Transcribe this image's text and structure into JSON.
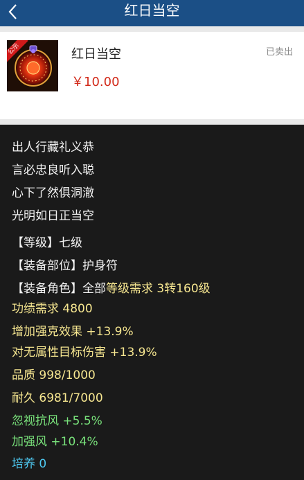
{
  "header": {
    "title": "红日当空",
    "back_icon": "chevron-left-icon"
  },
  "item": {
    "name": "红日当空",
    "price": "￥10.00",
    "status": "已卖出",
    "badge": "公示",
    "thumb_icon": "red-sun-amulet-icon"
  },
  "description": {
    "poem": [
      "出人行藏礼义恭",
      "言必忠良听入聪",
      "心下了然俱洞澈",
      "光明如日正当空"
    ],
    "level": "【等级】七级",
    "slot": "【装备部位】护身符",
    "role": "【装备角色】全部",
    "level_req": "等级需求 3转160级",
    "merit_req": "功绩需求 4800",
    "stats": [
      "增加强克效果 +13.9%",
      "对无属性目标伤害 +13.9%"
    ],
    "quality": "品质 998/1000",
    "durability": "耐久 6981/7000",
    "green_stats": [
      "忽视抗风 +5.5%",
      "加强风 +10.4%"
    ],
    "cultivation": "培养 0"
  },
  "colors": {
    "header_bg": "#1b4f86",
    "price": "#d22a1a",
    "panel_bg": "#1a1a1a",
    "white_text": "#f2f2f2",
    "yellow_text": "#f6e690",
    "green_text": "#79e27b",
    "cyan_text": "#4ec8f0"
  }
}
